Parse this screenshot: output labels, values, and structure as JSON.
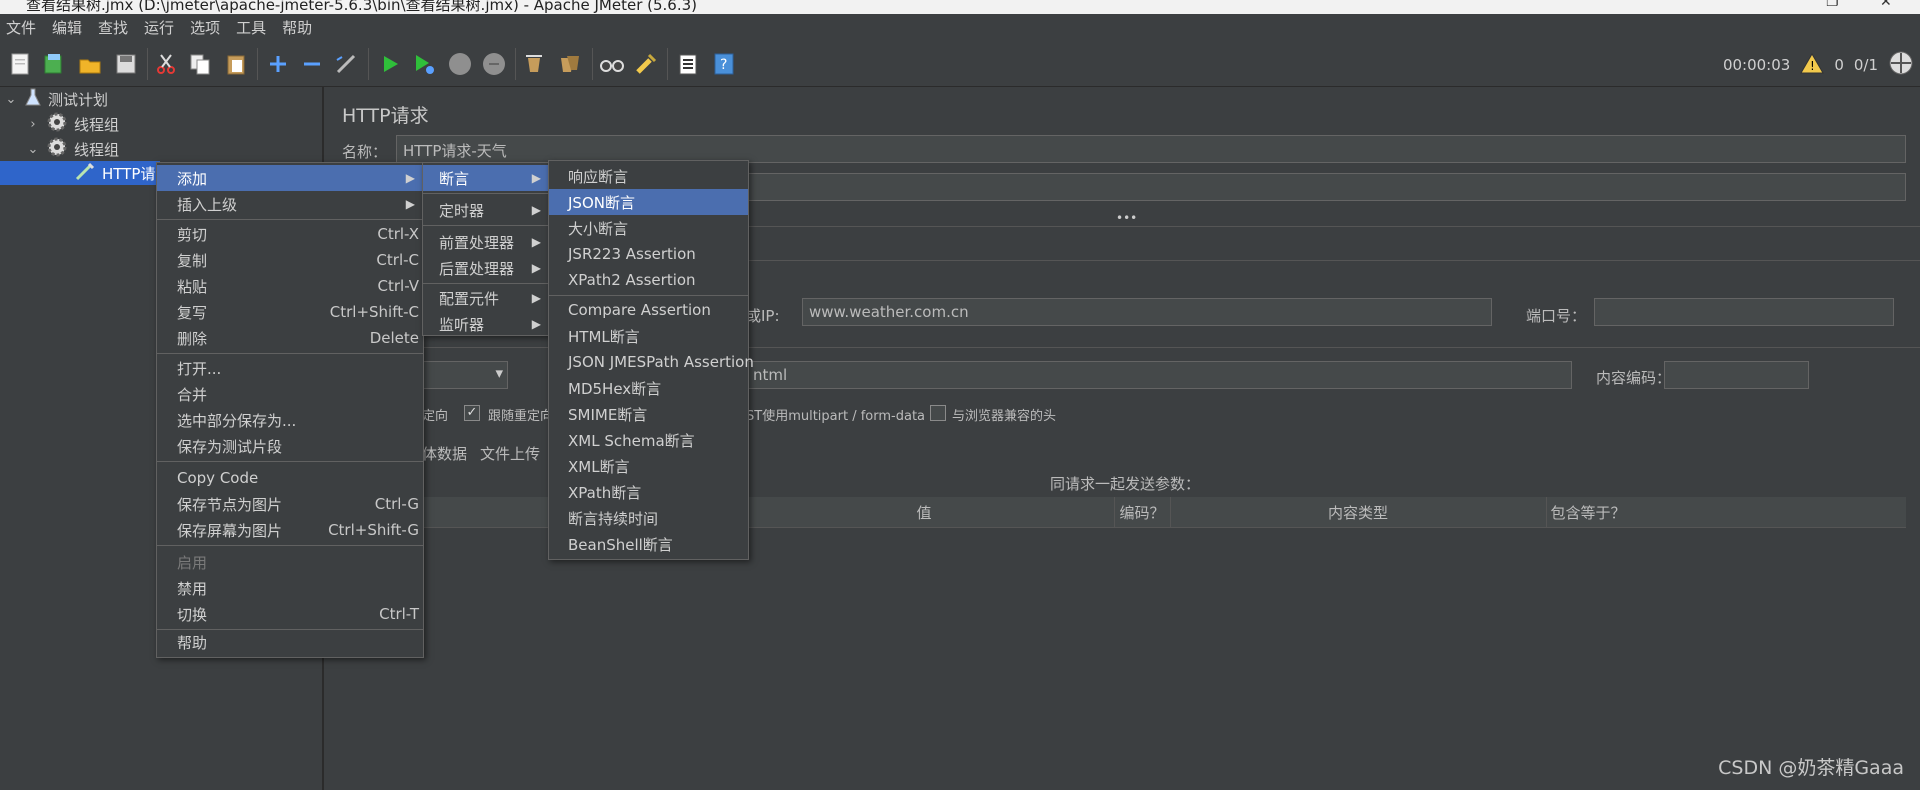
{
  "window": {
    "title": "查看结果树.jmx (D:\\jmeter\\apache-jmeter-5.6.3\\bin\\查看结果树.jmx) - Apache JMeter (5.6.3)"
  },
  "menubar": [
    "文件",
    "编辑",
    "查找",
    "运行",
    "选项",
    "工具",
    "帮助"
  ],
  "status": {
    "elapsed": "00:00:03",
    "warnings": "0",
    "threads": "0/1"
  },
  "tree": {
    "root": "测试计划",
    "group1": "线程组",
    "group2": "线程组",
    "sampler": "HTTP请求"
  },
  "panel": {
    "title": "HTTP请求",
    "name_label": "名称：",
    "name_value": "HTTP请求-天气",
    "server_label": "或IP:",
    "server_value": "www.weather.com.cn",
    "port_label": "端口号：",
    "path_suffix": "ntml",
    "encoding_label": "内容编码：",
    "cb_redirect_auto": "定向",
    "cb_follow_redirect": "跟随重定向",
    "cb_multipart": "ST使用multipart / form-data",
    "cb_browser_headers": "与浏览器兼容的头",
    "tab_body": "体数据",
    "tab_files": "文件上传",
    "params_heading": "同请求一起发送参数：",
    "columns": [
      "值",
      "编码？",
      "内容类型",
      "包含等于？"
    ]
  },
  "context_menu": {
    "items": [
      {
        "label": "添加",
        "shortcut": "",
        "submenu": true,
        "selected": true
      },
      {
        "label": "插入上级",
        "shortcut": "",
        "submenu": true
      },
      {
        "label": "剪切",
        "shortcut": "Ctrl-X"
      },
      {
        "label": "复制",
        "shortcut": "Ctrl-C"
      },
      {
        "label": "粘贴",
        "shortcut": "Ctrl-V"
      },
      {
        "label": "复写",
        "shortcut": "Ctrl+Shift-C"
      },
      {
        "label": "删除",
        "shortcut": "Delete"
      },
      {
        "label": "打开...",
        "shortcut": ""
      },
      {
        "label": "合并",
        "shortcut": ""
      },
      {
        "label": "选中部分保存为...",
        "shortcut": ""
      },
      {
        "label": "保存为测试片段",
        "shortcut": ""
      },
      {
        "label": "Copy Code",
        "shortcut": ""
      },
      {
        "label": "保存节点为图片",
        "shortcut": "Ctrl-G"
      },
      {
        "label": "保存屏幕为图片",
        "shortcut": "Ctrl+Shift-G"
      },
      {
        "label": "启用",
        "shortcut": "",
        "disabled": true
      },
      {
        "label": "禁用",
        "shortcut": ""
      },
      {
        "label": "切换",
        "shortcut": "Ctrl-T"
      },
      {
        "label": "帮助",
        "shortcut": ""
      }
    ]
  },
  "add_submenu": {
    "items": [
      "断言",
      "定时器",
      "前置处理器",
      "后置处理器",
      "配置元件",
      "监听器"
    ]
  },
  "assertion_submenu": {
    "items": [
      "响应断言",
      "JSON断言",
      "大小断言",
      "JSR223 Assertion",
      "XPath2 Assertion",
      "Compare Assertion",
      "HTML断言",
      "JSON JMESPath Assertion",
      "MD5Hex断言",
      "SMIME断言",
      "XML Schema断言",
      "XML断言",
      "XPath断言",
      "断言持续时间",
      "BeanShell断言"
    ]
  },
  "watermark": "CSDN @奶茶精Gaaa",
  "colors": {
    "background": "#3c3f41",
    "selection": "#4b6eaf",
    "tree_selection": "#2f65ca",
    "field": "#45494a"
  }
}
